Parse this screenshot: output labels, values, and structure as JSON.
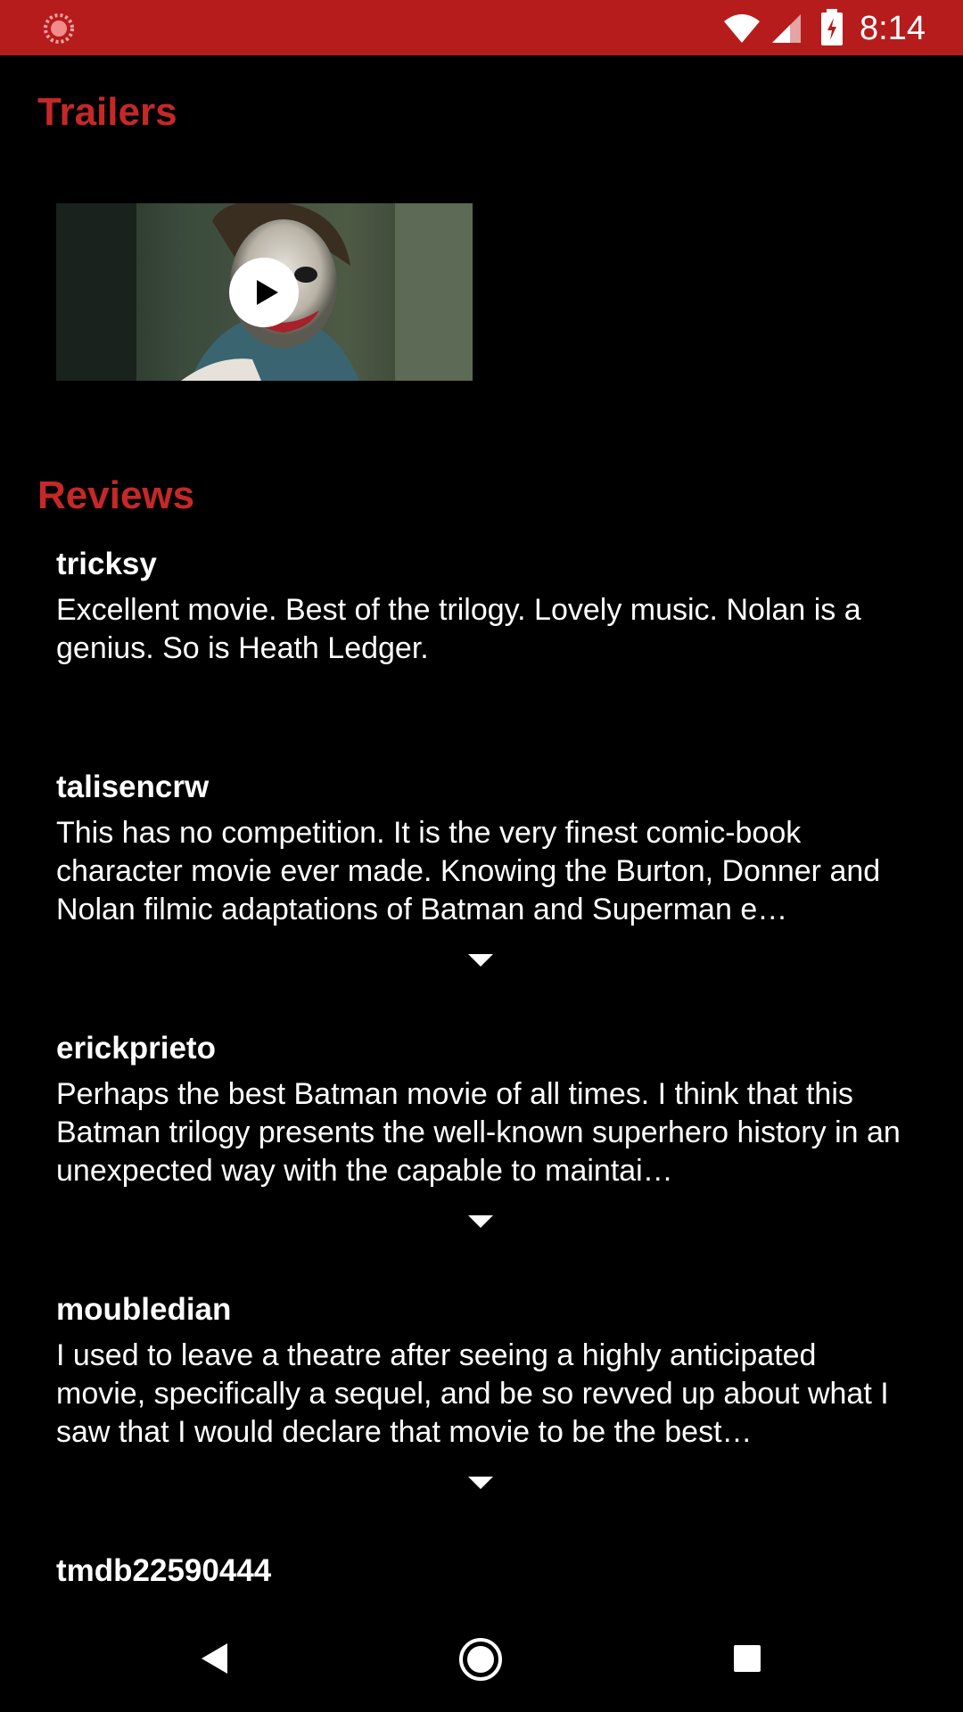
{
  "status_bar": {
    "time": "8:14",
    "left_icon": "loading-icon",
    "icons": [
      "wifi-icon",
      "signal-icon",
      "battery-charging-icon"
    ],
    "background_color": "#b71c1c"
  },
  "accent_color": "#c62828",
  "trailers": {
    "title": "Trailers",
    "play_icon": "play-icon"
  },
  "reviews": {
    "title": "Reviews",
    "items": [
      {
        "author": "tricksy",
        "content": "Excellent movie. Best of the trilogy. Lovely music. Nolan is a genius. So is Heath Ledger."
      },
      {
        "author": "talisencrw",
        "content": "This has no competition. It is the very finest comic-book character movie ever made. Knowing the Burton, Donner and Nolan filmic adaptations of Batman and Superman e…"
      },
      {
        "author": "erickprieto",
        "content": "Perhaps the best Batman movie of all times. I think that this Batman trilogy presents the well-known superhero history in an unexpected way with the capable to maintai…"
      },
      {
        "author": "moubledian",
        "content": "I used to leave a theatre after seeing a highly anticipated movie, specifically a sequel, and be so revved up about what I saw that I would declare that movie to be the best…"
      },
      {
        "author": "tmdb22590444",
        "content": ""
      }
    ]
  },
  "nav_bar": {
    "icons": [
      "back-icon",
      "home-icon",
      "recents-icon"
    ]
  }
}
